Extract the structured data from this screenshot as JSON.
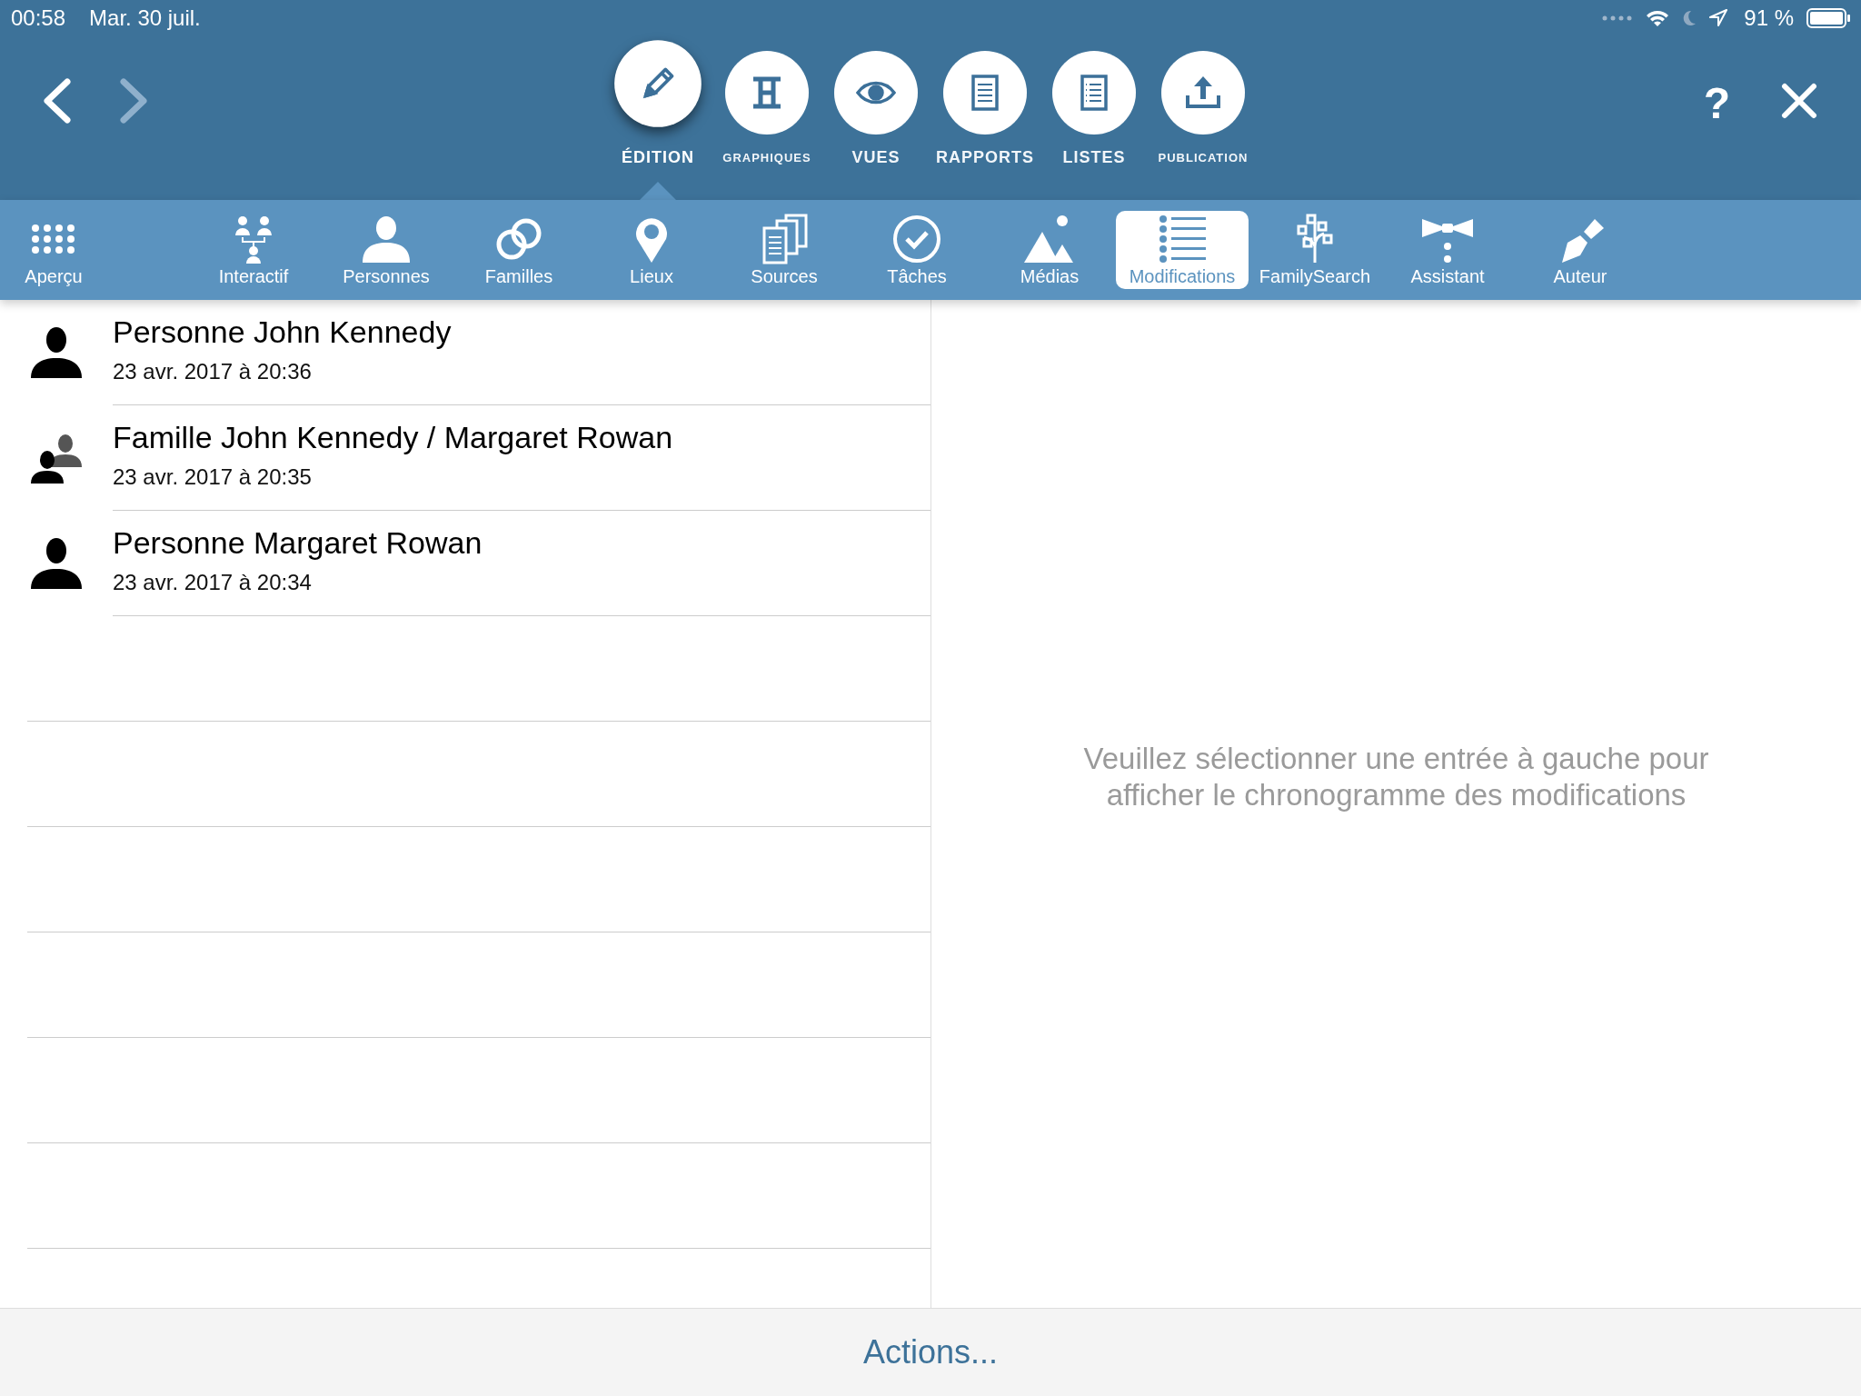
{
  "status_bar": {
    "time": "00:58",
    "date": "Mar. 30 juil.",
    "battery": "91 %"
  },
  "header": {
    "main_tabs": [
      {
        "label": "ÉDITION",
        "kind": "pencil",
        "selected": true
      },
      {
        "label": "GRAPHIQUES",
        "kind": "chart",
        "selected": false
      },
      {
        "label": "VUES",
        "kind": "eye",
        "selected": false
      },
      {
        "label": "RAPPORTS",
        "kind": "report",
        "selected": false
      },
      {
        "label": "LISTES",
        "kind": "list",
        "selected": false
      },
      {
        "label": "PUBLICATION",
        "kind": "upload",
        "selected": false
      }
    ],
    "forward_disabled": true,
    "help": "?"
  },
  "toolbar": [
    {
      "label": "Aperçu",
      "kind": "grid",
      "selected": false
    },
    {
      "label": "Interactif",
      "kind": "tree",
      "selected": false
    },
    {
      "label": "Personnes",
      "kind": "person",
      "selected": false
    },
    {
      "label": "Familles",
      "kind": "rings",
      "selected": false
    },
    {
      "label": "Lieux",
      "kind": "pin",
      "selected": false
    },
    {
      "label": "Sources",
      "kind": "docs",
      "selected": false
    },
    {
      "label": "Tâches",
      "kind": "check",
      "selected": false
    },
    {
      "label": "Médias",
      "kind": "mountain",
      "selected": false
    },
    {
      "label": "Modifications",
      "kind": "list",
      "selected": true
    },
    {
      "label": "FamilySearch",
      "kind": "branches",
      "selected": false
    },
    {
      "label": "Assistant",
      "kind": "bowtie",
      "selected": false
    },
    {
      "label": "Auteur",
      "kind": "pen",
      "selected": false
    }
  ],
  "changes": [
    {
      "kind": "person",
      "title": "Personne John Kennedy",
      "date": "23 avr. 2017 à 20:36"
    },
    {
      "kind": "family",
      "title": "Famille John Kennedy / Margaret Rowan",
      "date": "23 avr. 2017 à 20:35"
    },
    {
      "kind": "person",
      "title": "Personne Margaret Rowan",
      "date": "23 avr. 2017 à 20:34"
    }
  ],
  "detail": {
    "message": "Veuillez sélectionner une entrée à gauche pour afficher le chronogramme des modifications"
  },
  "bottom_bar": {
    "action": "Actions..."
  }
}
